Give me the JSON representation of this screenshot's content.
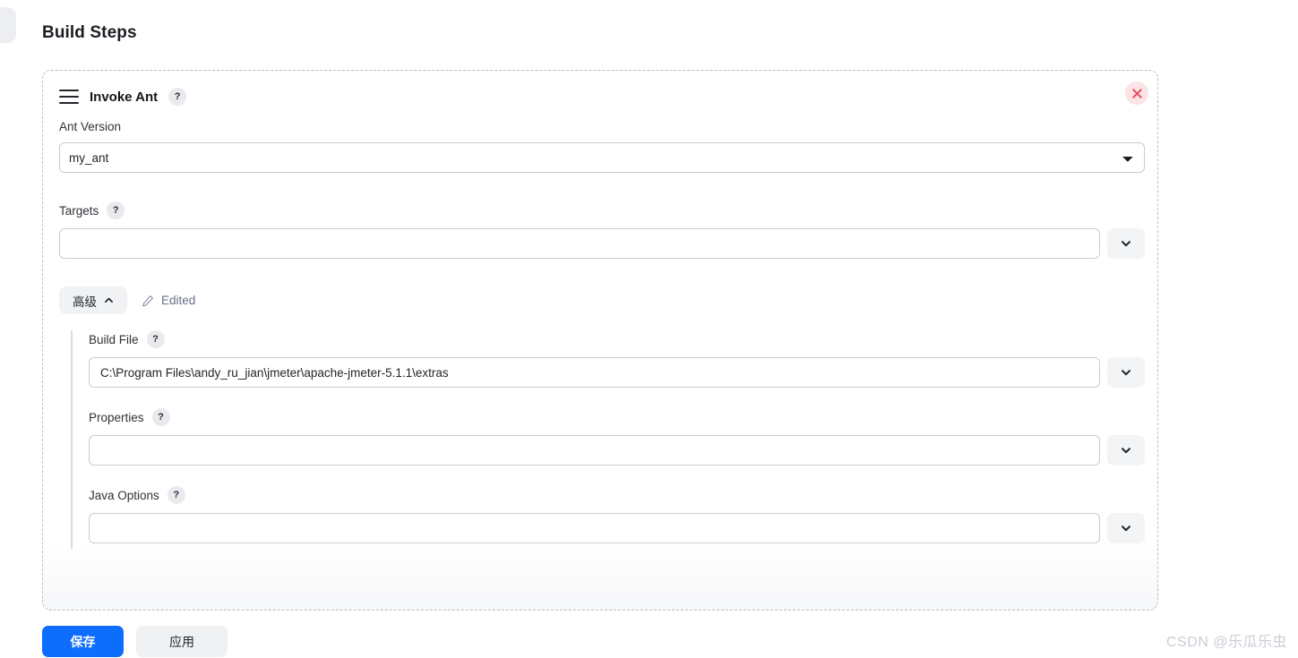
{
  "page": {
    "title": "Build Steps",
    "watermark": "CSDN @乐瓜乐虫"
  },
  "step": {
    "name": "Invoke Ant",
    "drag_handle_icon": "hamburger-drag-icon",
    "help_icon": "question-mark-icon",
    "help_label": "?",
    "close_icon": "close-x-icon",
    "close_color": "#e8505b",
    "close_bg": "#fbe3e6",
    "fields": {
      "ant_version": {
        "label": "Ant Version",
        "value": "my_ant",
        "options": [
          "my_ant"
        ],
        "dropdown_icon": "chevron-down-icon"
      },
      "targets": {
        "label": "Targets",
        "help_label": "?",
        "value": "",
        "placeholder": "",
        "expand_icon": "chevron-down-icon"
      }
    },
    "advanced": {
      "toggle_label": "高级",
      "toggle_icon": "chevron-up-icon",
      "expanded": true,
      "edited_label": "Edited",
      "edited_icon": "pencil-icon",
      "fields": [
        {
          "label": "Build File",
          "help_label": "?",
          "value": "C:\\Program Files\\andy_ru_jian\\jmeter\\apache-jmeter-5.1.1\\extras",
          "placeholder": "",
          "expand_icon": "chevron-down-icon"
        },
        {
          "label": "Properties",
          "help_label": "?",
          "value": "",
          "placeholder": "",
          "expand_icon": "chevron-down-icon"
        },
        {
          "label": "Java Options",
          "help_label": "?",
          "value": "",
          "placeholder": "",
          "expand_icon": "chevron-down-icon"
        }
      ]
    }
  },
  "footer": {
    "save_label": "保存",
    "apply_label": "应用",
    "save_color": "#0d6efd"
  }
}
